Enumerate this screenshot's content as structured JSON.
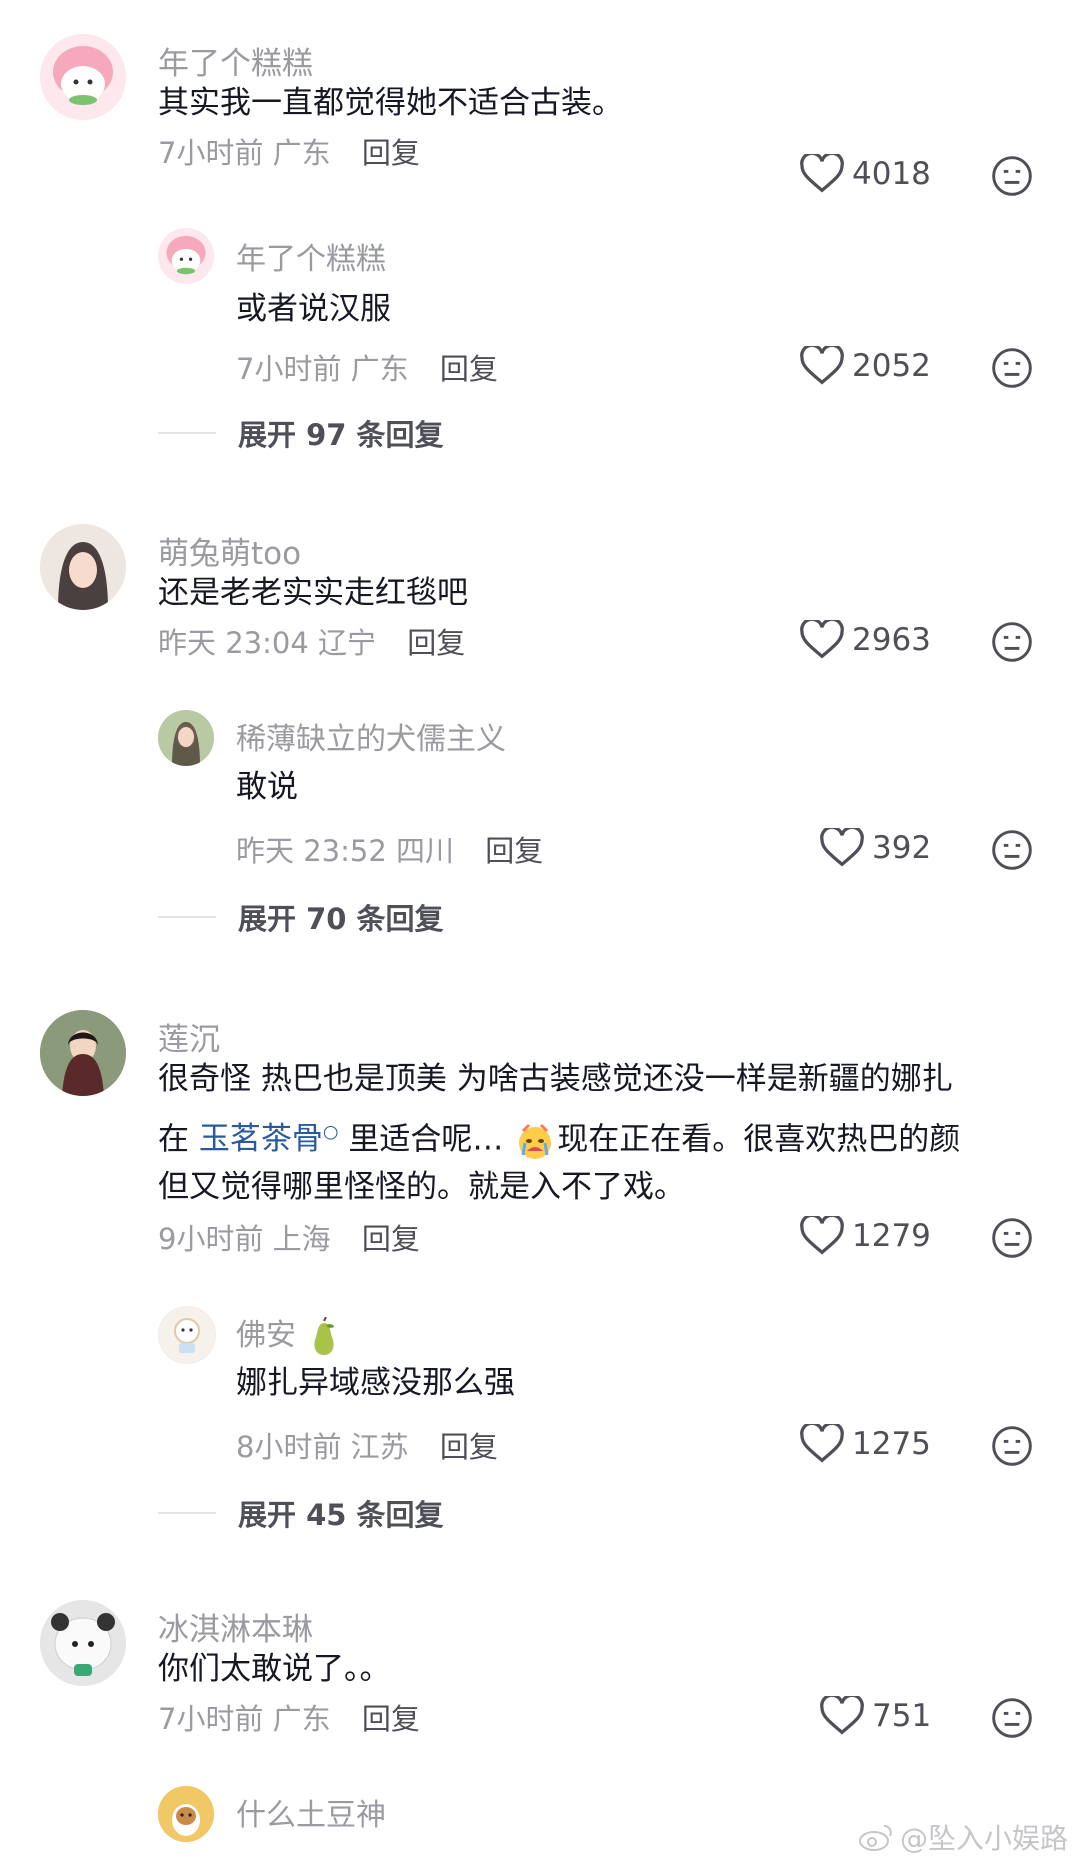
{
  "comments": [
    {
      "user": "年了个糕糕",
      "text": "其实我一直都觉得她不适合古装。",
      "time": "7小时前",
      "location": "广东",
      "reply_label": "回复",
      "likes": "4018",
      "replies": [
        {
          "user": "年了个糕糕",
          "text": "或者说汉服",
          "time": "7小时前",
          "location": "广东",
          "reply_label": "回复",
          "likes": "2052"
        }
      ],
      "expand_label": "展开 97 条回复"
    },
    {
      "user": "萌兔萌too",
      "text": "还是老老实实走红毯吧",
      "time": "昨天 23:04",
      "location": "辽宁",
      "reply_label": "回复",
      "likes": "2963",
      "replies": [
        {
          "user": "稀薄缺立的犬儒主义",
          "text": "敢说",
          "time": "昨天 23:52",
          "location": "四川",
          "reply_label": "回复",
          "likes": "392"
        }
      ],
      "expand_label": "展开 70 条回复"
    },
    {
      "user": "莲沉",
      "text_line1": "很奇怪 热巴也是顶美 为啥古装感觉还没一样是新疆的娜扎",
      "text_line2_pre": "在 ",
      "text_line2_tag": "玉茗茶骨",
      "text_line2_post": " 里适合呢…",
      "text_line2_rest": "现在正在看。很喜欢热巴的颜",
      "text_line3": "但又觉得哪里怪怪的。就是入不了戏。",
      "time": "9小时前",
      "location": "上海",
      "reply_label": "回复",
      "likes": "1279",
      "replies": [
        {
          "user": "佛安",
          "text": "娜扎异域感没那么强",
          "time": "8小时前",
          "location": "江苏",
          "reply_label": "回复",
          "likes": "1275"
        }
      ],
      "expand_label": "展开 45 条回复"
    },
    {
      "user": "冰淇淋本琳",
      "text": "你们太敢说了。。",
      "time": "7小时前",
      "location": "广东",
      "reply_label": "回复",
      "likes": "751",
      "replies": [
        {
          "user": "什么土豆神"
        }
      ]
    }
  ],
  "watermark": "@坠入小娱路",
  "colors": {
    "meta": "#9a9ba1",
    "hashtag": "#2a5a9c",
    "text": "#161823"
  }
}
